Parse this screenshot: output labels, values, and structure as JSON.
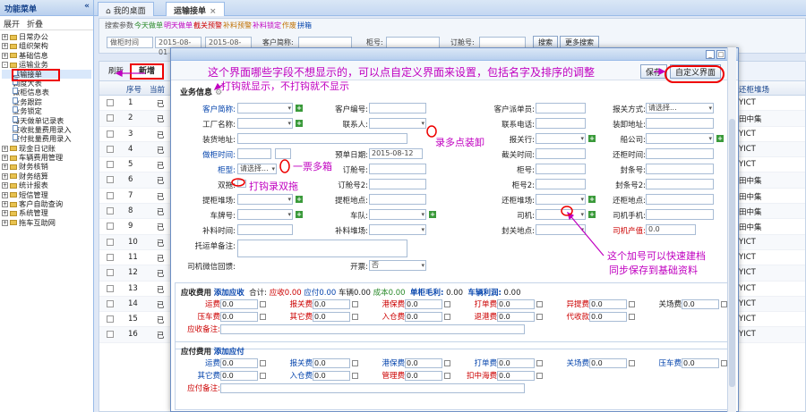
{
  "sidebar": {
    "title": "功能菜单",
    "collapse": "«",
    "expand": "展开",
    "fold": "折叠",
    "items": [
      {
        "label": "日常办公",
        "level": 0,
        "sign": "+"
      },
      {
        "label": "组织架构",
        "level": 0,
        "sign": "+"
      },
      {
        "label": "基础信息",
        "level": 0,
        "sign": "+"
      },
      {
        "label": "运输业务",
        "level": 0,
        "sign": "-"
      },
      {
        "label": "运输接单",
        "level": 1
      },
      {
        "label": "调度大表",
        "level": 1
      },
      {
        "label": "做柜信息表",
        "level": 1
      },
      {
        "label": "业务跟踪",
        "level": 1
      },
      {
        "label": "业务锁定",
        "level": 1
      },
      {
        "label": "每天做单记录表",
        "level": 1
      },
      {
        "label": "应收批量费用录入",
        "level": 1
      },
      {
        "label": "应付批量费用录入",
        "level": 1
      },
      {
        "label": "现金日记账",
        "level": 0,
        "sign": "+"
      },
      {
        "label": "车辆费用管理",
        "level": 0,
        "sign": "+"
      },
      {
        "label": "财务核销",
        "level": 0,
        "sign": "+"
      },
      {
        "label": "财务结算",
        "level": 0,
        "sign": "+"
      },
      {
        "label": "统计报表",
        "level": 0,
        "sign": "+"
      },
      {
        "label": "短信管理",
        "level": 0,
        "sign": "+"
      },
      {
        "label": "客户自助查询",
        "level": 0,
        "sign": "+"
      },
      {
        "label": "系统管理",
        "level": 0,
        "sign": "+"
      },
      {
        "label": "拖车互助网",
        "level": 0,
        "sign": "+"
      }
    ]
  },
  "tabs": [
    {
      "label": "我的桌面"
    },
    {
      "label": "运输接单",
      "close": "×"
    }
  ],
  "query": {
    "legend_prefix": "搜索参数",
    "legend": [
      {
        "t": "今天做单",
        "c": "#2a8a2a"
      },
      {
        "t": "明天做单",
        "c": "#c000c0"
      },
      {
        "t": "截关预警",
        "c": "#c00"
      },
      {
        "t": "补料预警",
        "c": "#c07000"
      },
      {
        "t": "补料锁定",
        "c": "#c000c0"
      },
      {
        "t": "作废",
        "c": "#c07000"
      },
      {
        "t": "拼箱",
        "c": "#0645ad"
      }
    ],
    "date_type": "做柜时间",
    "date_from": "2015-08-01",
    "date_to": "2015-08-31",
    "customer_label": "客户简称:",
    "cabinet_label": "柜号:",
    "order_label": "订舱号:",
    "search": "搜索",
    "more_search": "更多搜索"
  },
  "grid": {
    "tool": {
      "refresh": "刷新",
      "new": "新增"
    },
    "headers": {
      "seq": "序号",
      "status": "当前",
      "return_yard": "还柜堆场"
    },
    "rows": [
      {
        "no": "1",
        "status": "已",
        "right": "YICT"
      },
      {
        "no": "2",
        "status": "已",
        "right": "田中集"
      },
      {
        "no": "3",
        "status": "已",
        "right": "YICT"
      },
      {
        "no": "4",
        "status": "已",
        "right": "YICT"
      },
      {
        "no": "5",
        "status": "已",
        "right": "YICT"
      },
      {
        "no": "6",
        "status": "已",
        "right": "田中集"
      },
      {
        "no": "7",
        "status": "已",
        "right": "田中集"
      },
      {
        "no": "8",
        "status": "已",
        "right": "田中集"
      },
      {
        "no": "9",
        "status": "已",
        "right": "田中集"
      },
      {
        "no": "10",
        "status": "已",
        "right": "YICT"
      },
      {
        "no": "11",
        "status": "已",
        "right": "YICT"
      },
      {
        "no": "12",
        "status": "已",
        "right": "YICT"
      },
      {
        "no": "13",
        "status": "已",
        "right": "YICT"
      },
      {
        "no": "14",
        "status": "已",
        "right": "YICT"
      },
      {
        "no": "15",
        "status": "已",
        "right": "YICT"
      },
      {
        "no": "16",
        "status": "已",
        "right": "YICT"
      }
    ]
  },
  "dialog": {
    "save": "保存",
    "custom_ui": "自定义界面",
    "biz_title": "业务信息",
    "fields": {
      "customer": "客户简称:",
      "customer_no": "客户编号:",
      "dispatcher": "客户派单员:",
      "declare_mode": "报关方式:",
      "declare_mode_val": "请选择...",
      "factory": "工厂名称:",
      "contact": "联系人:",
      "contact_tel": "联系电话:",
      "load_contact": "装卸地址:",
      "load_addr": "装货地址:",
      "broker": "报关行:",
      "shipping_co": "船公司:",
      "do_time": "做柜时间:",
      "order_date": "预单日期:",
      "order_date_val": "2015-08-12",
      "cutoff": "截关时间:",
      "return_time": "还柜时间:",
      "box_type": "柜型:",
      "box_type_val": "请选择...",
      "booking_no": "订舱号:",
      "cabinet_no": "柜号:",
      "seal_no": "封条号:",
      "double": "双拖:",
      "booking_no2": "订舱号2:",
      "cabinet_no2": "柜号2:",
      "seal_no2": "封条号2:",
      "pick_yard": "提柜堆场:",
      "pick_place": "提柜地点:",
      "return_yard": "还柜堆场:",
      "return_place": "还柜地点:",
      "plate": "车牌号:",
      "team": "车队:",
      "driver": "司机:",
      "driver_phone": "司机手机:",
      "sup_time": "补料时间:",
      "sup_yard": "补料堆场:",
      "customs_place": "封关地点:",
      "driver_value": "司机产值:",
      "driver_value_val": "0.0",
      "remark": "托运单备注:",
      "wechat": "司机微信回馈:",
      "invoice": "开票:",
      "invoice_val": "否"
    },
    "receivable": {
      "title": "应收费用",
      "add": "添加应收",
      "total_label": "合计:",
      "ys_label": "应收0.00",
      "yf_label": "应付0.00",
      "cl_label": "车辆0.00",
      "cb_label": "成本0.00",
      "dgml_label": "单柜毛利:",
      "dgml_val": "0.00",
      "clrl_label": "车辆利润:",
      "clrl_val": "0.00",
      "rows": [
        [
          {
            "l": "运费",
            "c": "rd"
          },
          {
            "l": "报关费",
            "c": "rd"
          },
          {
            "l": "港保费",
            "c": "rd"
          },
          {
            "l": "打单费",
            "c": "rd"
          },
          {
            "l": "异提费",
            "c": "rd"
          },
          {
            "l": "关场费",
            "c": ""
          }
        ],
        [
          {
            "l": "压车费",
            "c": "rd"
          },
          {
            "l": "其它费",
            "c": "rd"
          },
          {
            "l": "入仓费",
            "c": "rd"
          },
          {
            "l": "退港费",
            "c": "rd"
          },
          {
            "l": "代收款",
            "c": "rd"
          }
        ]
      ],
      "val": "0.0",
      "remark": "应收备注:"
    },
    "payable": {
      "title": "应付费用",
      "add": "添加应付",
      "rows": [
        [
          {
            "l": "运费",
            "c": "bl"
          },
          {
            "l": "报关费",
            "c": "bl"
          },
          {
            "l": "港保费",
            "c": "bl"
          },
          {
            "l": "打单费",
            "c": "bl"
          },
          {
            "l": "关场费",
            "c": "bl"
          },
          {
            "l": "压车费",
            "c": "bl"
          }
        ],
        [
          {
            "l": "其它费",
            "c": "bl"
          },
          {
            "l": "入仓费",
            "c": "bl"
          },
          {
            "l": "管理费",
            "c": "rd"
          },
          {
            "l": "扣中海费",
            "c": "rd"
          }
        ]
      ],
      "val": "0.0",
      "remark": "应付备注:"
    }
  },
  "annotations": {
    "a1": "这个界面哪些字段不想显示的，可以点自定义界面来设置，包括名字及排序的调整",
    "a2": "打钩就显示，不打钩就不显示",
    "a3": "录多点装卸",
    "a4": "一票多箱",
    "a5": "打钩录双拖",
    "a6": "这个加号可以快速建档",
    "a7": "同步保存到基础资料"
  }
}
